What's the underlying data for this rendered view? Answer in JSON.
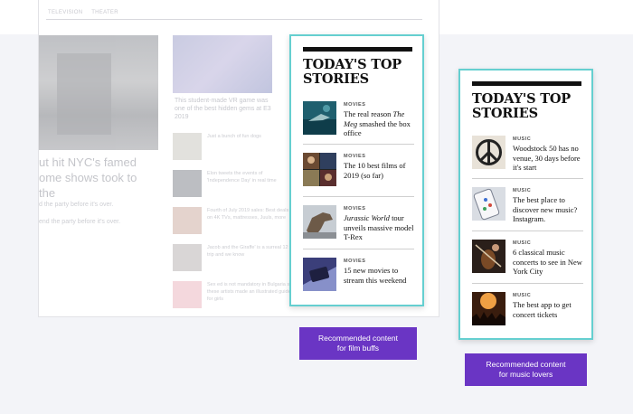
{
  "background_page": {
    "nav": [
      "TELEVISION",
      "THEATER"
    ],
    "headline": "ut hit NYC's famed ome shows took to the",
    "subs": [
      "d the party before it's over.",
      "end the party before it's over."
    ],
    "card_text": "This student-made VR game was one of the best hidden gems at E3 2019",
    "small_items": [
      "Just a bunch of fun dogs",
      "Elon tweets the events of 'Independence Day' in real time",
      "Fourth of July 2019 sales: Best deals on 4K TVs, mattresses, Juuls, more",
      "Jacob and the Giraffe' is a surreal 12 trip and we know",
      "Sex ed is not mandatory in Bulgaria so these artists made an illustrated guide for girls"
    ]
  },
  "film_card": {
    "title": "TODAY'S TOP STORIES",
    "stories": [
      {
        "category": "MOVIES",
        "text_pre": "The real reason ",
        "text_em": "The Meg",
        "text_post": " smashed the box office",
        "thumb": "shark-underwater-icon"
      },
      {
        "category": "MOVIES",
        "text_pre": "The 10 best films of 2019 (so far)",
        "text_em": "",
        "text_post": "",
        "thumb": "film-collage-icon"
      },
      {
        "category": "MOVIES",
        "text_pre": "",
        "text_em": "Jurassic World",
        "text_post": " tour unveils massive model T-Rex",
        "thumb": "t-rex-icon"
      },
      {
        "category": "MOVIES",
        "text_pre": "15 new movies to stream this weekend",
        "text_em": "",
        "text_post": "",
        "thumb": "streaming-device-icon"
      }
    ],
    "label": "Recommended content for film buffs"
  },
  "music_card": {
    "title": "TODAY'S TOP STORIES",
    "stories": [
      {
        "category": "MUSIC",
        "text_pre": "Woodstock 50 has no venue, 30 days before it's start",
        "text_em": "",
        "text_post": "",
        "thumb": "peace-sign-icon"
      },
      {
        "category": "MUSIC",
        "text_pre": "The best place to discover new music? Instagram.",
        "text_em": "",
        "text_post": "",
        "thumb": "phone-app-icon"
      },
      {
        "category": "MUSIC",
        "text_pre": "6 classical music concerts to see in New York City",
        "text_em": "",
        "text_post": "",
        "thumb": "violinist-icon"
      },
      {
        "category": "MUSIC",
        "text_pre": "The best app to get concert tickets",
        "text_em": "",
        "text_post": "",
        "thumb": "concert-crowd-icon"
      }
    ],
    "label": "Recommended content for music lovers"
  },
  "colors": {
    "card_border": "#65cfd0",
    "label_bg": "#6a35c4",
    "page_bg": "#f3f4f8"
  }
}
